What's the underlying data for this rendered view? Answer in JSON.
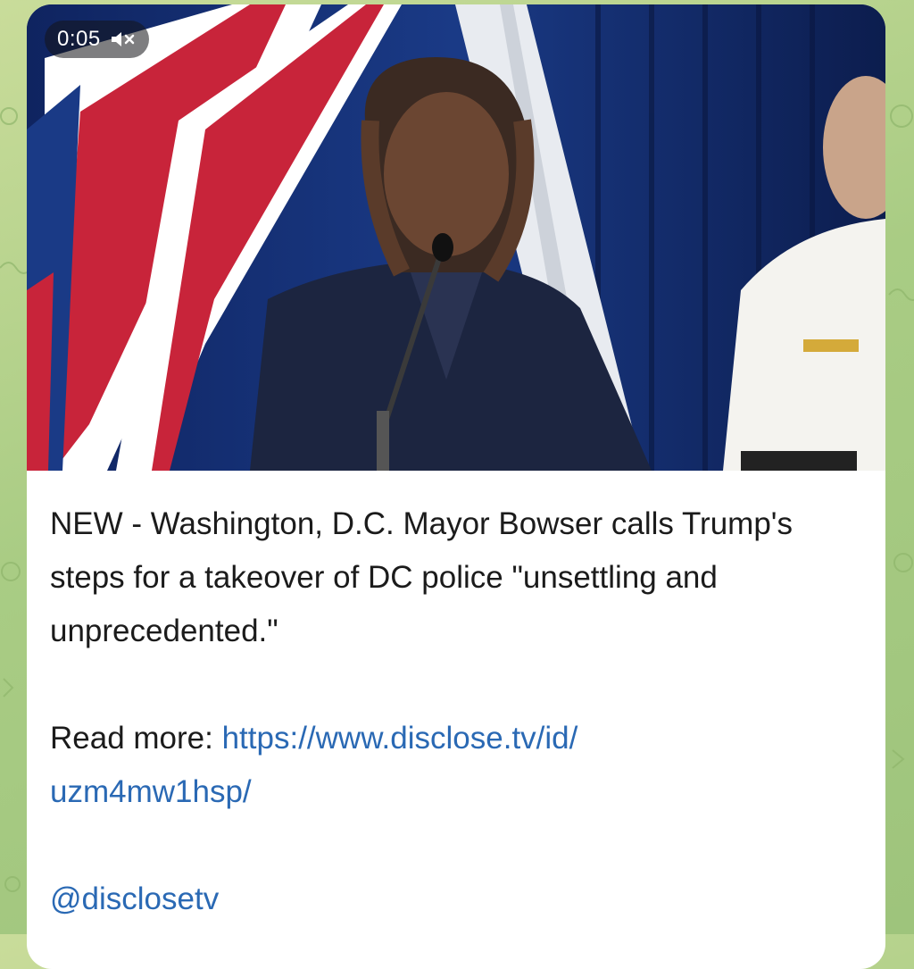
{
  "video": {
    "duration": "0:05",
    "mute_icon": "speaker-muted-icon"
  },
  "message": {
    "text": "NEW - Washington, D.C. Mayor Bowser calls Trump's steps for a takeover of DC police \"unsettling and unprecedented.\"",
    "read_more_label": "Read more: ",
    "link_line1": "https://www.disclose.tv/id/",
    "link_line2": "uzm4mw1hsp/",
    "handle": "@disclosetv"
  },
  "colors": {
    "link": "#2a69b4",
    "background": "#a9cc84"
  }
}
